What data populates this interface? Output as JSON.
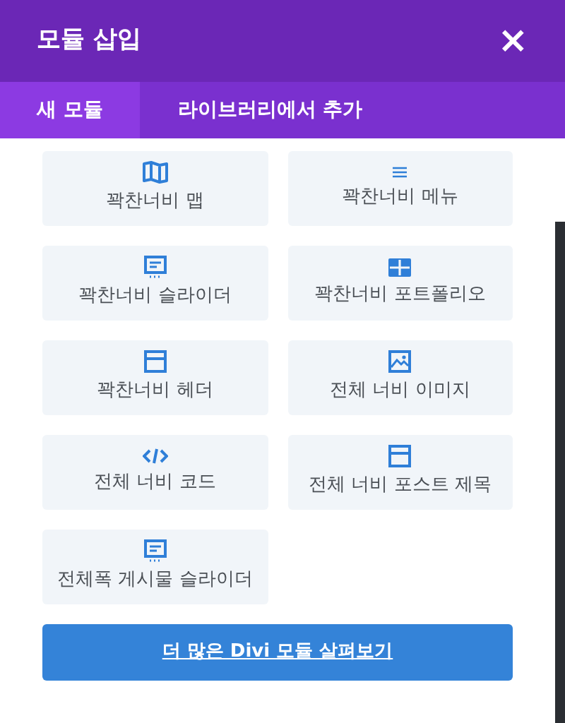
{
  "window": {
    "title": "모듈 삽입",
    "close": "×"
  },
  "tabs": [
    {
      "label": "새 모듈",
      "selected": true
    },
    {
      "label": "라이브러리에서 추가",
      "selected": false
    }
  ],
  "modules": [
    {
      "label": "꽉찬너비 맵",
      "kind": "map"
    },
    {
      "label": "꽉찬너비 메뉴",
      "kind": "menu"
    },
    {
      "label": "꽉찬너비 슬라이더",
      "kind": "slider"
    },
    {
      "label": "꽉찬너비 포트폴리오",
      "kind": "grid"
    },
    {
      "label": "꽉찬너비 헤더",
      "kind": "header"
    },
    {
      "label": "전체 너비 이미지",
      "kind": "image"
    },
    {
      "label": "전체 너비 코드",
      "kind": "code"
    },
    {
      "label": "전체 너비 포스트 제목",
      "kind": "header"
    },
    {
      "label": "전체폭 게시물 슬라이더",
      "kind": "slider"
    }
  ],
  "more_button": "더 많은 Divi 모듈 살펴보기"
}
